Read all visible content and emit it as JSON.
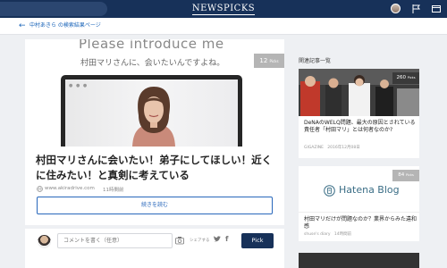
{
  "header": {
    "logo": "NEWSPICKS",
    "icons": [
      "avatar",
      "flag-icon",
      "window-icon"
    ]
  },
  "breadcrumb": {
    "text": "中村あきら の検索結果ページ"
  },
  "article": {
    "hero_heading": "Please introduce me",
    "hero_sub": "村田マリさんに、会いたいんですよね。",
    "picks_count": "12",
    "picks_unit": "Picks",
    "title": "村田マリさんに会いたい！弟子にしてほしい！近くに住みたい！と真剣に考えている",
    "site": "www.akiradrive.com",
    "time": "11時間前",
    "read_more": "続きを読む"
  },
  "comment_bar": {
    "placeholder": "コメントを書く（任意）",
    "share_label": "シェアする",
    "pick_button": "Pick"
  },
  "related": {
    "heading": "関連記事一覧",
    "items": [
      {
        "title": "DeNAのWELQ問題、最大の原因とされている責任者「村田マリ」とは何者なのか?",
        "source": "GIGAZINE",
        "time": "2016年12月08日",
        "picks": "260",
        "picks_unit": "Picks"
      },
      {
        "title": "村田マリだけが問題なのか？業界からみた違和感",
        "source": "shuse's diary",
        "time": "14時間前",
        "picks": "84",
        "picks_unit": "Picks",
        "image_text": "Hatena Blog"
      }
    ]
  },
  "colors": {
    "navy": "#173159",
    "link_blue": "#1a64b9"
  }
}
